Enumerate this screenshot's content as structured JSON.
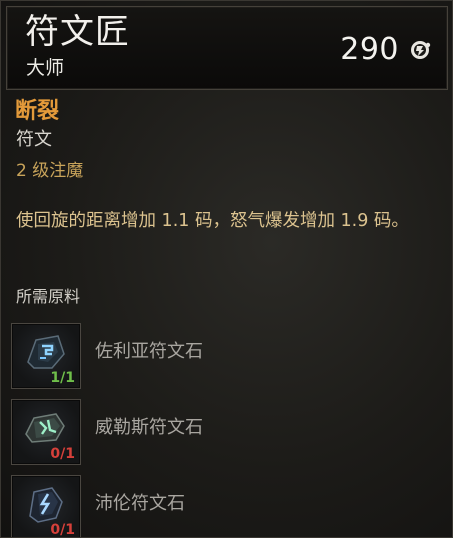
{
  "header": {
    "title": "符文匠",
    "subtitle": "大师",
    "cost": "290",
    "cost_icon": "gold-coin-icon"
  },
  "item": {
    "name": "断裂",
    "type": "符文",
    "level": "2 级注魔",
    "description": "使回旋的距离增加 1.1 码，怒气爆发增加 1.9 码。"
  },
  "materials": {
    "title": "所需原料",
    "items": [
      {
        "name": "佐利亚符文石",
        "count": "1/1",
        "count_color": "#6fbf4a",
        "icon": "rune-stone-blue-icon"
      },
      {
        "name": "威勒斯符文石",
        "count": "0/1",
        "count_color": "#d6403a",
        "icon": "rune-stone-green-icon"
      },
      {
        "name": "沛伦符文石",
        "count": "0/1",
        "count_color": "#d6403a",
        "icon": "rune-stone-lightning-icon"
      }
    ]
  }
}
